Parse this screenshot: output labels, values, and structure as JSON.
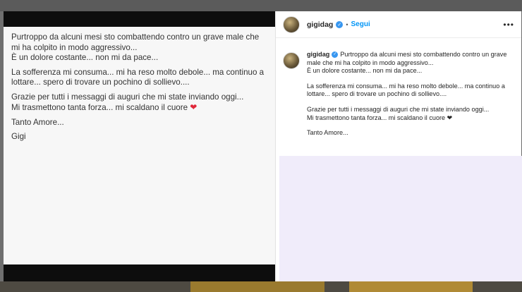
{
  "media_post": {
    "paragraphs": [
      "Purtroppo da alcuni mesi sto combattendo contro un grave male che mi ha colpito in modo aggressivo...\nÈ un dolore costante... non mi da pace...",
      "La sofferenza mi consuma... mi ha reso molto debole... ma continuo a lottare... spero di trovare un pochino di sollievo....",
      "Grazie per tutti i messaggi di auguri che mi state inviando oggi...\nMi trasmettono tanta forza... mi scaldano il cuore",
      "Tanto Amore...",
      "Gigi"
    ],
    "heart": "❤"
  },
  "post": {
    "username": "gigidag",
    "follow_label": "Segui",
    "separator": "•",
    "more_label": "•••",
    "caption": {
      "username": "gigidag",
      "paragraphs": [
        "Purtroppo da alcuni mesi sto combattendo contro un grave male che mi ha colpito in modo aggressivo...\nÈ un dolore costante... non mi da pace...",
        "La sofferenza mi consuma... mi ha reso molto debole... ma continuo a lottare... spero di trovare un pochino di sollievo....",
        "Grazie per tutti i messaggi di auguri che mi state inviando oggi...\nMi trasmettono tanta forza... mi scaldano il cuore ❤",
        "Tanto Amore..."
      ]
    }
  },
  "colors": {
    "follow_blue": "#0095f6",
    "verified_blue": "#3897f0",
    "heart_red": "#e0283a"
  }
}
